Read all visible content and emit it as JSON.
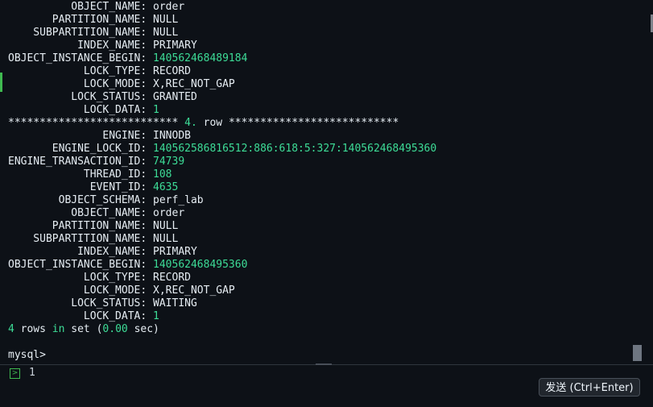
{
  "terminal": {
    "lines": [
      {
        "key": "     OBJECT_NAME:",
        "value": "order",
        "value_type": "text"
      },
      {
        "key": "  PARTITION_NAME:",
        "value": "NULL",
        "value_type": "text"
      },
      {
        "key": "SUBPARTITION_NAME:",
        "value": "NULL",
        "value_type": "text"
      },
      {
        "key": "      INDEX_NAME:",
        "value": "PRIMARY",
        "value_type": "text"
      },
      {
        "key": "OBJECT_INSTANCE_BEGIN:",
        "value": "140562468489184",
        "value_type": "num"
      },
      {
        "key": "       LOCK_TYPE:",
        "value": "RECORD",
        "value_type": "text"
      },
      {
        "key": "       LOCK_MODE:",
        "value": "X,REC_NOT_GAP",
        "value_type": "text"
      },
      {
        "key": "     LOCK_STATUS:",
        "value": "GRANTED",
        "value_type": "text"
      },
      {
        "key": "       LOCK_DATA:",
        "value": "1",
        "value_type": "num"
      }
    ],
    "row_separator": {
      "stars_left": "***************************",
      "row_number": "4.",
      "row_word": "row",
      "stars_right": "***************************"
    },
    "row4": [
      {
        "key": "          ENGINE:",
        "value": "INNODB",
        "value_type": "text"
      },
      {
        "key": "  ENGINE_LOCK_ID:",
        "value": "140562586816512:886:618:5:327:140562468495360",
        "value_type": "num"
      },
      {
        "key": "ENGINE_TRANSACTION_ID:",
        "value": "74739",
        "value_type": "num"
      },
      {
        "key": "       THREAD_ID:",
        "value": "108",
        "value_type": "num"
      },
      {
        "key": "        EVENT_ID:",
        "value": "4635",
        "value_type": "num"
      },
      {
        "key": "   OBJECT_SCHEMA:",
        "value": "perf_lab",
        "value_type": "text"
      },
      {
        "key": "     OBJECT_NAME:",
        "value": "order",
        "value_type": "text"
      },
      {
        "key": "  PARTITION_NAME:",
        "value": "NULL",
        "value_type": "text"
      },
      {
        "key": "SUBPARTITION_NAME:",
        "value": "NULL",
        "value_type": "text"
      },
      {
        "key": "      INDEX_NAME:",
        "value": "PRIMARY",
        "value_type": "text"
      },
      {
        "key": "OBJECT_INSTANCE_BEGIN:",
        "value": "140562468495360",
        "value_type": "num"
      },
      {
        "key": "       LOCK_TYPE:",
        "value": "RECORD",
        "value_type": "text"
      },
      {
        "key": "       LOCK_MODE:",
        "value": "X,REC_NOT_GAP",
        "value_type": "text"
      },
      {
        "key": "     LOCK_STATUS:",
        "value": "WAITING",
        "value_type": "text"
      },
      {
        "key": "       LOCK_DATA:",
        "value": "1",
        "value_type": "num"
      }
    ],
    "summary": {
      "count": "4",
      "rows_word": "rows",
      "in_word": "in",
      "set_word": "set",
      "open_paren": "(",
      "time": "0.00",
      "unit": "sec)"
    },
    "prompt": "mysql>"
  },
  "input": {
    "line_number": "1",
    "prompt_icon": "terminal-prompt-icon"
  },
  "send_button": {
    "label": "发送 (Ctrl+Enter)"
  },
  "colors": {
    "background": "#0d1117",
    "text": "#e6edf3",
    "number": "#3ddc97",
    "accent_green": "#3fb950"
  }
}
